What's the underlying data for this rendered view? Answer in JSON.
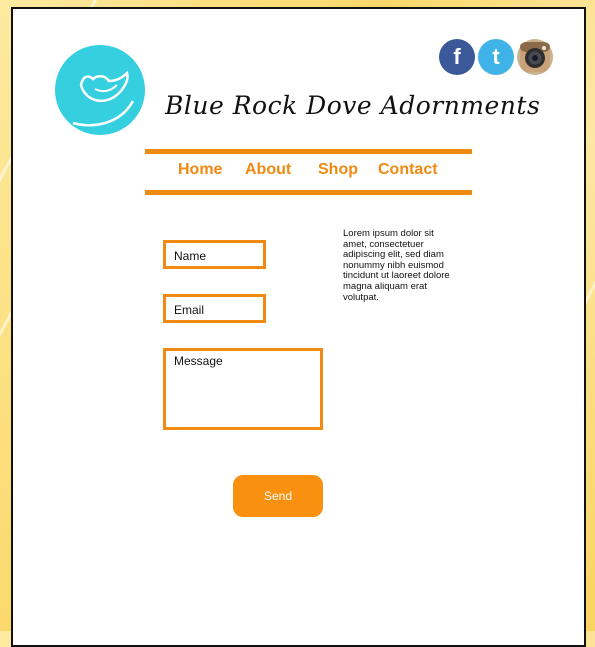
{
  "site": {
    "title": "Blue Rock Dove Adornments",
    "logo_icon": "dove-icon"
  },
  "social": {
    "facebook_glyph": "f",
    "twitter_glyph": "t",
    "instagram_icon": "camera-icon"
  },
  "nav": {
    "items": [
      "Home",
      "About",
      "Shop",
      "Contact"
    ]
  },
  "form": {
    "name_placeholder": "Name",
    "email_placeholder": "Email",
    "message_placeholder": "Message",
    "send_label": "Send"
  },
  "sidebar_text": "Lorem ipsum dolor sit amet, consectetuer adipiscing elit, sed diam nonummy nibh euismod tincidunt ut laoreet dolore magna aliquam erat volutpat.",
  "colors": {
    "accent": "#f08a12",
    "logo": "#35cfe0",
    "facebook": "#3b5998",
    "twitter": "#3fb3e8"
  }
}
